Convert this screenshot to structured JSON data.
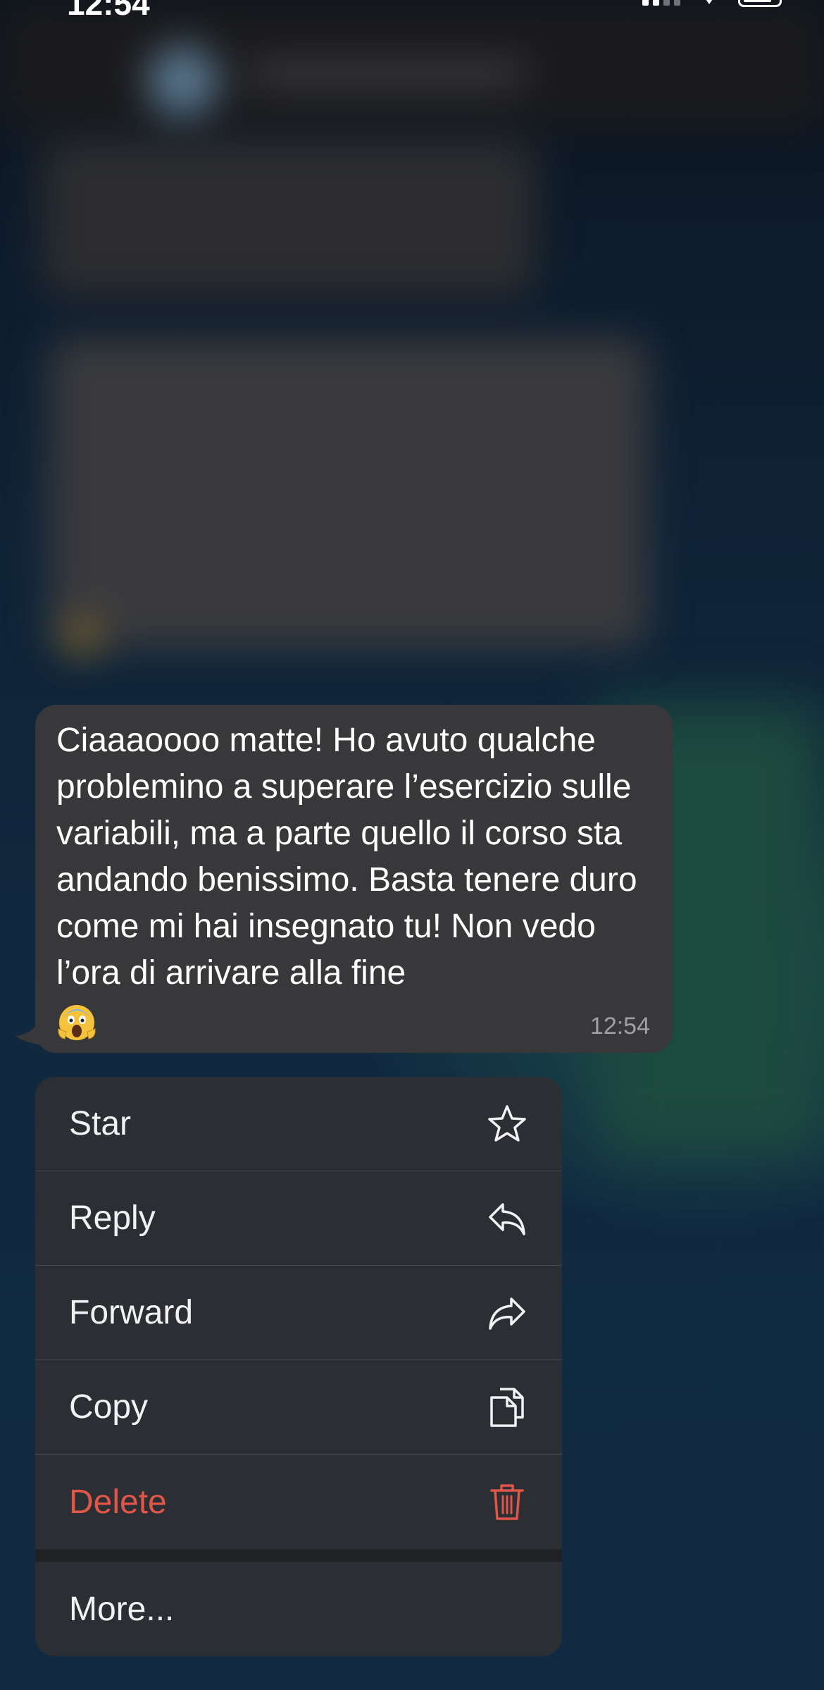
{
  "status_bar": {
    "time": "12:54"
  },
  "message": {
    "text": "Ciaaaoooo matte! Ho avuto qualche problemino a superare l’esercizio sulle variabili, ma a parte quello il corso sta andando benissimo. Basta tenere duro come mi hai insegnato tu! Non vedo l’ora di arrivare alla fine",
    "emoji": "😱",
    "time": "12:54"
  },
  "menu": {
    "items": [
      {
        "label": "Star",
        "icon": "star-icon"
      },
      {
        "label": "Reply",
        "icon": "reply-icon"
      },
      {
        "label": "Forward",
        "icon": "forward-icon"
      },
      {
        "label": "Copy",
        "icon": "copy-icon"
      },
      {
        "label": "Delete",
        "icon": "trash-icon"
      }
    ],
    "more_label": "More..."
  },
  "colors": {
    "bubble": "#38383b",
    "menu_background": "#2b2e32",
    "danger": "#e0574a",
    "text": "#ffffff"
  }
}
